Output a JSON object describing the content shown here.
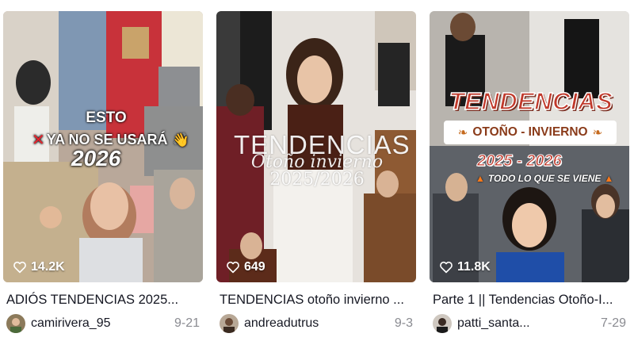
{
  "colors": {
    "text": "#161823",
    "muted": "#8a8b91",
    "accent_red": "#c0392b"
  },
  "videos": [
    {
      "plays": "14.2K",
      "title": "ADIÓS TENDENCIAS 2025...",
      "username": "camirivera_95",
      "date": "9-21",
      "overlay": {
        "line1": "ESTO",
        "line2": "YA NO SE USARÁ",
        "line3": "2026",
        "x_icon": "✕",
        "emoji": "👋"
      }
    },
    {
      "plays": "649",
      "title": "TENDENCIAS otoño invierno ...",
      "username": "andreadutrus",
      "date": "9-3",
      "overlay": {
        "line1": "TENDENCIAS",
        "line2": "Otoño invierno",
        "line3": "2025/2026"
      }
    },
    {
      "plays": "11.8K",
      "title": "Parte 1 || Tendencias Otoño-I...",
      "username": "patti_santa...",
      "date": "7-29",
      "overlay": {
        "line1": "TENDENCIAS",
        "line2": "OTOÑO - INVIERNO",
        "line3": "2025 - 2026",
        "line4": "TODO LO QUE SE VIENE"
      }
    }
  ]
}
